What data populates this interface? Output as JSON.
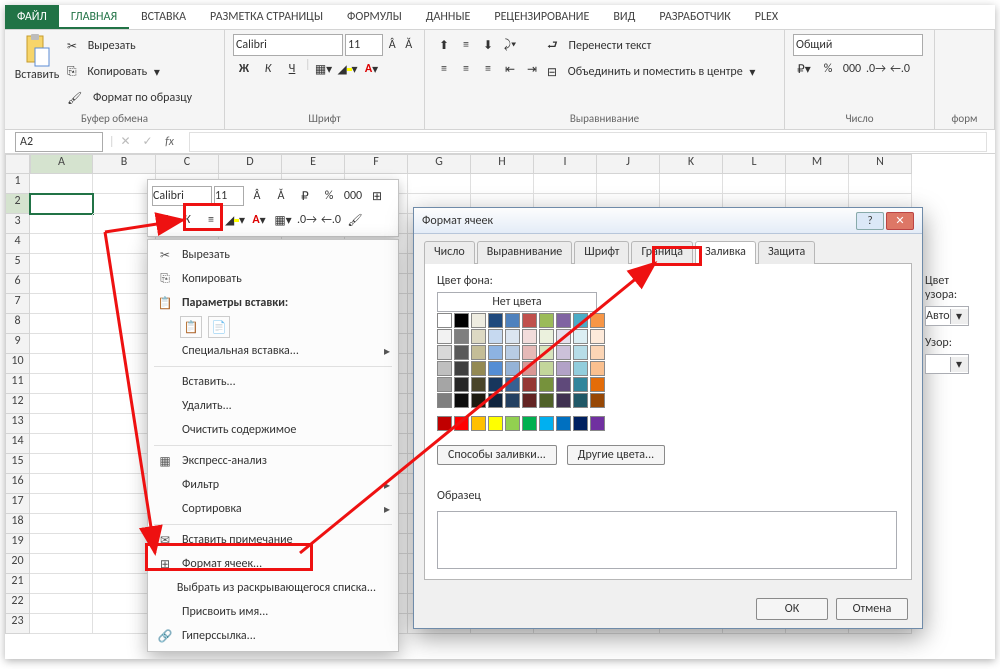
{
  "tabs": {
    "file": "ФАЙЛ",
    "home": "ГЛАВНАЯ",
    "insert": "ВСТАВКА",
    "layout": "РАЗМЕТКА СТРАНИЦЫ",
    "formulas": "ФОРМУЛЫ",
    "data": "ДАННЫЕ",
    "review": "РЕЦЕНЗИРОВАНИЕ",
    "view": "ВИД",
    "dev": "РАЗРАБОТЧИК",
    "plex": "PLEX"
  },
  "clipboard": {
    "paste": "Вставить",
    "cut": "Вырезать",
    "copy": "Копировать",
    "format_painter": "Формат по образцу",
    "group": "Буфер обмена"
  },
  "font": {
    "family": "Calibri",
    "size": "11",
    "group": "Шрифт",
    "bold": "Ж",
    "italic": "К",
    "underline": "Ч"
  },
  "align": {
    "wrap": "Перенести текст",
    "merge": "Объединить и поместить в центре",
    "group": "Выравнивание"
  },
  "number": {
    "format": "Общий",
    "group": "Число"
  },
  "truncated": "форм",
  "namebox": "A2",
  "columns": [
    "A",
    "B",
    "C",
    "D",
    "E",
    "F",
    "G",
    "H",
    "I",
    "J",
    "K",
    "L",
    "M",
    "N"
  ],
  "rows": [
    "1",
    "2",
    "3",
    "4",
    "5",
    "6",
    "7",
    "8",
    "9",
    "10",
    "11",
    "12",
    "13",
    "14",
    "15",
    "16",
    "17",
    "18",
    "19",
    "20",
    "21",
    "22",
    "23"
  ],
  "mini": {
    "font": "Calibri",
    "size": "11"
  },
  "ctx": {
    "cut": "Вырезать",
    "copy": "Копировать",
    "paste_opts": "Параметры вставки:",
    "paste_special": "Специальная вставка...",
    "insert": "Вставить...",
    "delete": "Удалить...",
    "clear": "Очистить содержимое",
    "quick": "Экспресс-анализ",
    "filter": "Фильтр",
    "sort": "Сортировка",
    "comment": "Вставить примечание",
    "format": "Формат ячеек...",
    "dropdown": "Выбрать из раскрывающегося списка...",
    "name": "Присвоить имя...",
    "link": "Гиперссылка..."
  },
  "dlg": {
    "title": "Формат ячеек",
    "tabs": {
      "number": "Число",
      "align": "Выравнивание",
      "font": "Шрифт",
      "border": "Граница",
      "fill": "Заливка",
      "protect": "Защита"
    },
    "bgcolor_label": "Цвет фона:",
    "nocolor_btn": "Нет цвета",
    "pat_color_label": "Цвет узора:",
    "auto": "Авто",
    "pattern_label": "Узор:",
    "fill_effects_btn": "Способы заливки...",
    "more_colors_btn": "Другие цвета...",
    "sample_label": "Образец",
    "ok": "ОК",
    "cancel": "Отмена",
    "theme_colors": [
      [
        "#ffffff",
        "#000000",
        "#eeece1",
        "#1f497d",
        "#4f81bd",
        "#c0504d",
        "#9bbb59",
        "#8064a2",
        "#4bacc6",
        "#f79646"
      ],
      [
        "#f2f2f2",
        "#7f7f7f",
        "#ddd9c3",
        "#c6d9f0",
        "#dbe5f1",
        "#f2dcdb",
        "#ebf1dd",
        "#e5e0ec",
        "#dbeef3",
        "#fdeada"
      ],
      [
        "#d8d8d8",
        "#595959",
        "#c4bd97",
        "#8db3e2",
        "#b8cce4",
        "#e5b9b7",
        "#d7e3bc",
        "#ccc1d9",
        "#b7dde8",
        "#fbd5b5"
      ],
      [
        "#bfbfbf",
        "#3f3f3f",
        "#938953",
        "#548dd4",
        "#95b3d7",
        "#d99694",
        "#c3d69b",
        "#b2a2c7",
        "#92cddc",
        "#fac08f"
      ],
      [
        "#a5a5a5",
        "#262626",
        "#494429",
        "#17365d",
        "#366092",
        "#953734",
        "#76923c",
        "#5f497a",
        "#31859b",
        "#e36c09"
      ],
      [
        "#7f7f7f",
        "#0c0c0c",
        "#1d1b10",
        "#0f243e",
        "#244061",
        "#632423",
        "#4f6128",
        "#3f3151",
        "#205867",
        "#974806"
      ]
    ],
    "std_colors": [
      "#c00000",
      "#ff0000",
      "#ffc000",
      "#ffff00",
      "#92d050",
      "#00b050",
      "#00b0f0",
      "#0070c0",
      "#002060",
      "#7030a0"
    ]
  }
}
